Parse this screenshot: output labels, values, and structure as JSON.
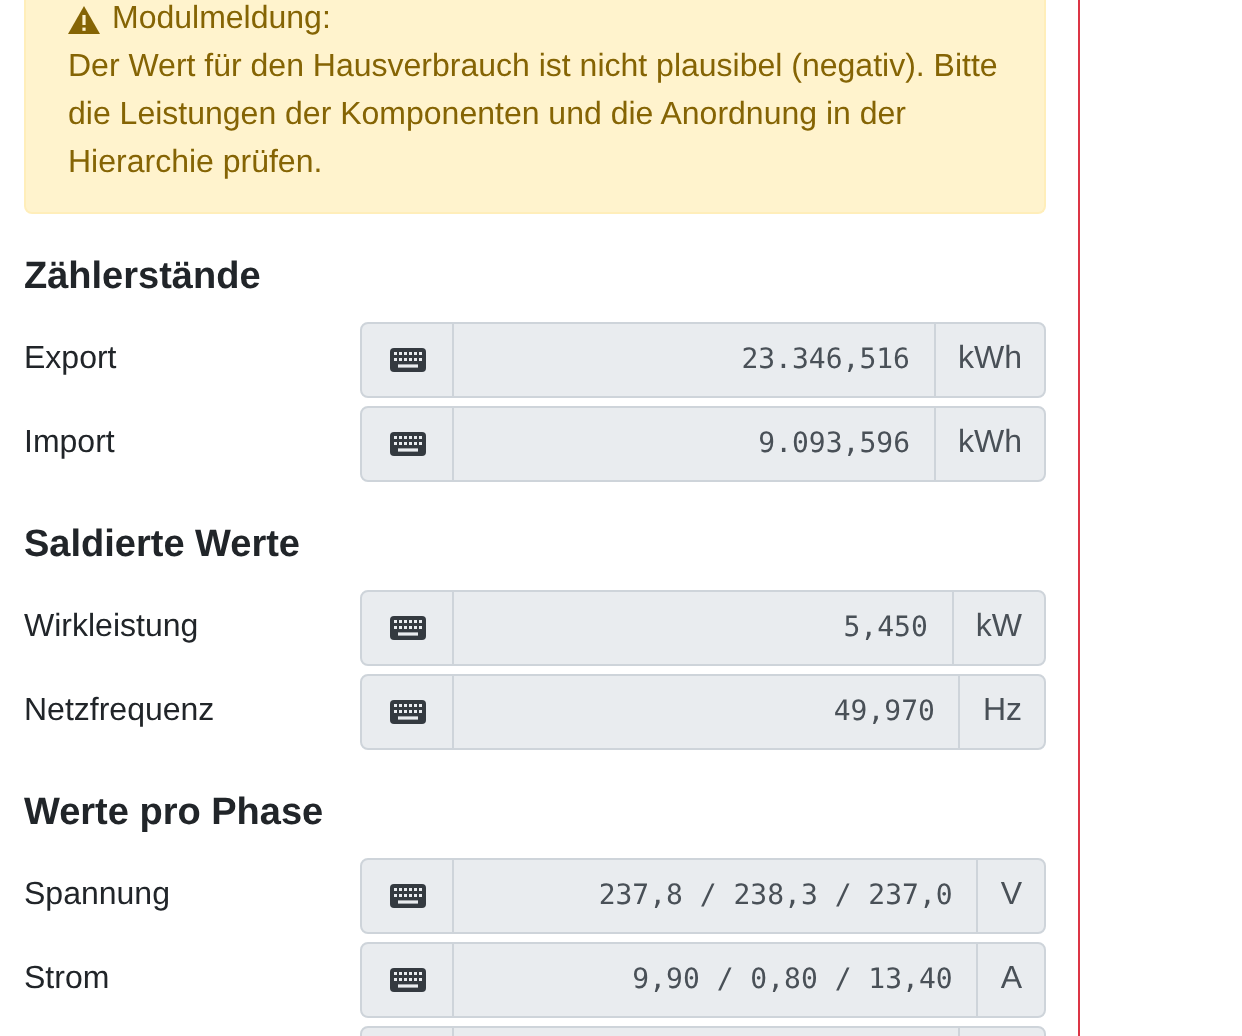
{
  "alert": {
    "title": "Modulmeldung:",
    "message": "Der Wert für den Hausverbrauch ist nicht plausibel (negativ). Bitte die Leistungen der Komponenten und die Anordnung in der Hierarchie prüfen."
  },
  "sections": [
    {
      "title": "Zählerstände",
      "rows": [
        {
          "label": "Export",
          "value": "23.346,516",
          "unit": "kWh"
        },
        {
          "label": "Import",
          "value": "9.093,596",
          "unit": "kWh"
        }
      ]
    },
    {
      "title": "Saldierte Werte",
      "rows": [
        {
          "label": "Wirkleistung",
          "value": "5,450",
          "unit": "kW"
        },
        {
          "label": "Netzfrequenz",
          "value": "49,970",
          "unit": "Hz"
        }
      ]
    },
    {
      "title": "Werte pro Phase",
      "rows": [
        {
          "label": "Spannung",
          "value": "237,8 / 238,3 / 237,0",
          "unit": "V"
        },
        {
          "label": "Strom",
          "value": "9,90 / 0,80 / 13,40",
          "unit": "A"
        }
      ]
    }
  ]
}
